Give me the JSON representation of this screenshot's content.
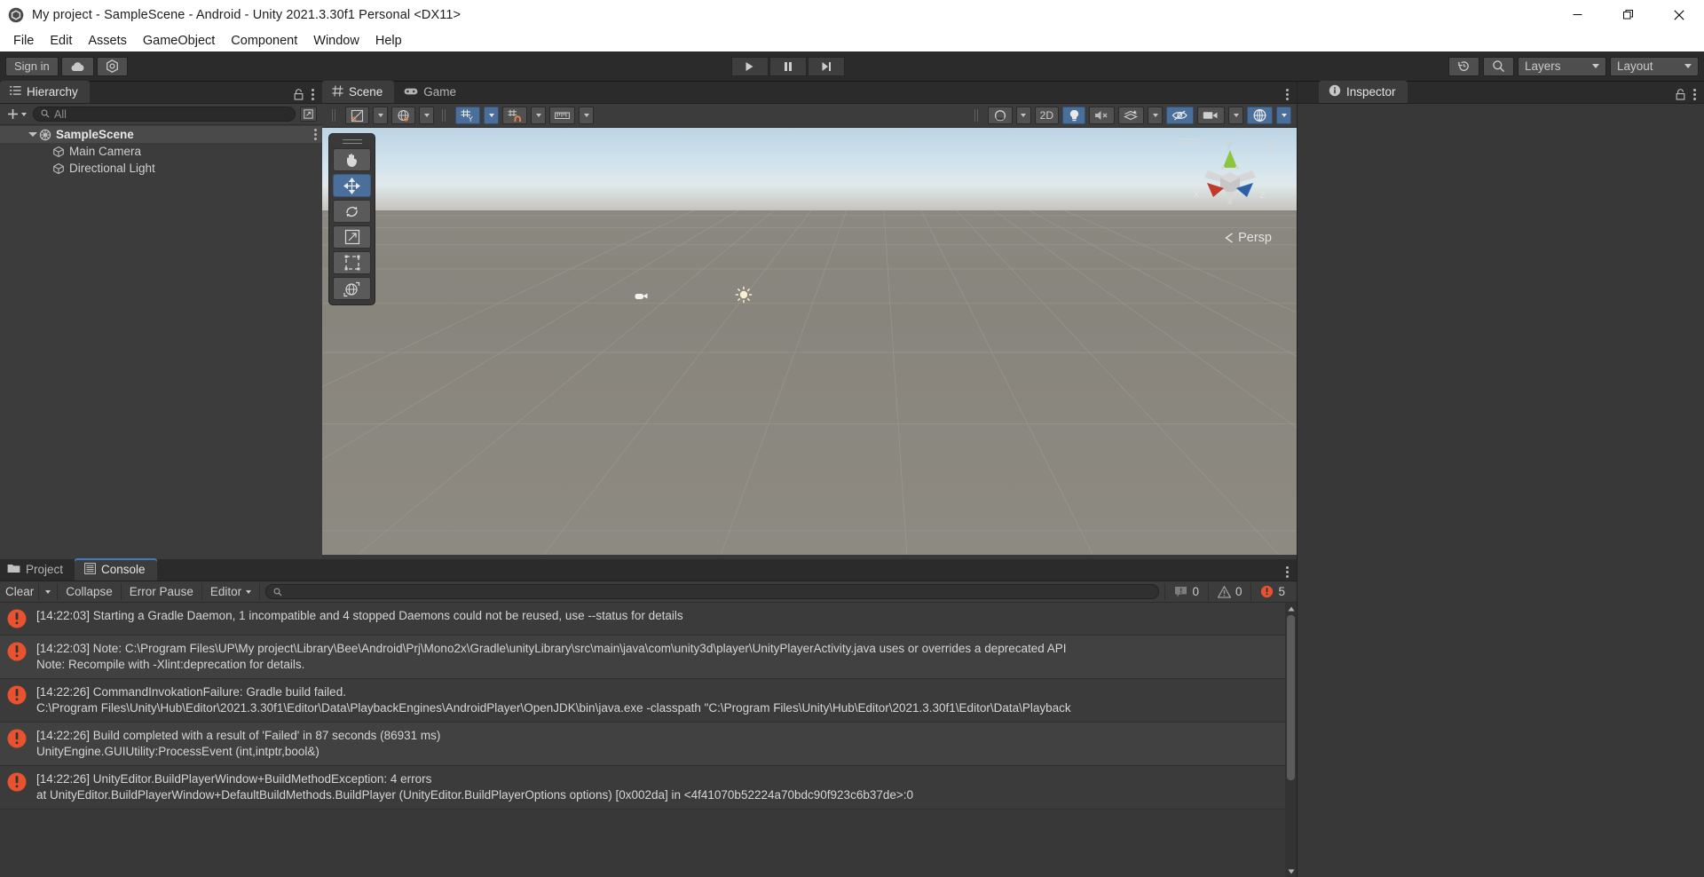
{
  "window": {
    "title": "My project - SampleScene - Android - Unity 2021.3.30f1 Personal <DX11>",
    "minimize_label": "Minimize",
    "maximize_label": "Restore",
    "close_label": "Close"
  },
  "menubar": {
    "items": [
      {
        "label": "File"
      },
      {
        "label": "Edit"
      },
      {
        "label": "Assets"
      },
      {
        "label": "GameObject"
      },
      {
        "label": "Component"
      },
      {
        "label": "Window"
      },
      {
        "label": "Help"
      }
    ]
  },
  "toolbar": {
    "signin_label": "Sign in",
    "cloud_label": "Unity Cloud",
    "services_label": "Unity Services",
    "play_label": "Play",
    "pause_label": "Pause",
    "step_label": "Step",
    "history_label": "Undo History",
    "search_label": "Search",
    "layers_label": "Layers",
    "layout_label": "Layout"
  },
  "hierarchy": {
    "tab_label": "Hierarchy",
    "tab_icon": "hierarchy-icon",
    "create_label": "+",
    "search_placeholder": "All",
    "search_value": "",
    "items": [
      {
        "label": "SampleScene",
        "depth": 0,
        "selected": true,
        "expanded": true,
        "icon": "scene-icon"
      },
      {
        "label": "Main Camera",
        "depth": 1,
        "selected": false,
        "icon": "gameobject-icon"
      },
      {
        "label": "Directional Light",
        "depth": 1,
        "selected": false,
        "icon": "gameobject-icon"
      }
    ]
  },
  "scene": {
    "tabs": [
      {
        "label": "Scene",
        "active": true,
        "icon": "scene-grid-icon"
      },
      {
        "label": "Game",
        "active": false,
        "icon": "gamepad-icon"
      }
    ],
    "toolbar": {
      "draw_mode_label": "Shaded",
      "render_mode_label": "Shading Mode",
      "two_d_label": "2D",
      "grid_axis_label": "Y",
      "snap_label": "Snap",
      "ruler_label": "Ruler",
      "gizmos_label": "Gizmos",
      "lighting_label": "Lighting",
      "audio_label": "Audio Off",
      "fx_label": "Effects",
      "visibility_label": "Scene Visibility",
      "camera_label": "Scene Camera",
      "gizmo_toggle_label": "Gizmos Toggle"
    },
    "tools": [
      {
        "name": "hand-tool",
        "active": false
      },
      {
        "name": "move-tool",
        "active": true
      },
      {
        "name": "rotate-tool",
        "active": false
      },
      {
        "name": "scale-tool",
        "active": false
      },
      {
        "name": "rect-tool",
        "active": false
      },
      {
        "name": "transform-tool",
        "active": false
      }
    ],
    "gizmo": {
      "x_label": "x",
      "y_label": "y",
      "z_label": "z",
      "projection_label": "Persp"
    },
    "objects": [
      {
        "name": "main-camera-gizmo",
        "label": "Main Camera"
      },
      {
        "name": "directional-light-gizmo",
        "label": "Directional Light"
      }
    ]
  },
  "bottom": {
    "tabs": [
      {
        "label": "Project",
        "active": false,
        "icon": "folder-icon"
      },
      {
        "label": "Console",
        "active": true,
        "icon": "console-icon"
      }
    ]
  },
  "console": {
    "clear_label": "Clear",
    "collapse_label": "Collapse",
    "error_pause_label": "Error Pause",
    "editor_label": "Editor",
    "search_placeholder": "",
    "search_value": "",
    "counts": {
      "log": "0",
      "warning": "0",
      "error": "5"
    },
    "entries": [
      {
        "severity": "error",
        "line1": "[14:22:03] Starting a Gradle Daemon, 1 incompatible and 4 stopped Daemons could not be reused, use --status for details",
        "line2": ""
      },
      {
        "severity": "error",
        "line1": "[14:22:03] Note: C:\\Program Files\\UP\\My project\\Library\\Bee\\Android\\Prj\\Mono2x\\Gradle\\unityLibrary\\src\\main\\java\\com\\unity3d\\player\\UnityPlayerActivity.java uses or overrides a deprecated API",
        "line2": "Note: Recompile with -Xlint:deprecation for details."
      },
      {
        "severity": "error",
        "line1": "[14:22:26] CommandInvokationFailure: Gradle build failed.",
        "line2": "C:\\Program Files\\Unity\\Hub\\Editor\\2021.3.30f1\\Editor\\Data\\PlaybackEngines\\AndroidPlayer\\OpenJDK\\bin\\java.exe -classpath \"C:\\Program Files\\Unity\\Hub\\Editor\\2021.3.30f1\\Editor\\Data\\Playback"
      },
      {
        "severity": "error",
        "line1": "[14:22:26] Build completed with a result of 'Failed' in 87 seconds (86931 ms)",
        "line2": "UnityEngine.GUIUtility:ProcessEvent (int,intptr,bool&)"
      },
      {
        "severity": "error",
        "line1": "[14:22:26] UnityEditor.BuildPlayerWindow+BuildMethodException: 4 errors",
        "line2": " at UnityEditor.BuildPlayerWindow+DefaultBuildMethods.BuildPlayer (UnityEditor.BuildPlayerOptions options) [0x002da] in <4f41070b52224a70bdc90f923c6b37de>:0"
      }
    ]
  },
  "inspector": {
    "tab_label": "Inspector",
    "tab_icon": "info-icon"
  },
  "colors": {
    "accent_blue": "#4b6f9b",
    "error_orange": "#e8522f",
    "panel_bg": "#383838",
    "tab_active": "#3c3c3c",
    "toolbar_bg": "#2b2b2b"
  }
}
